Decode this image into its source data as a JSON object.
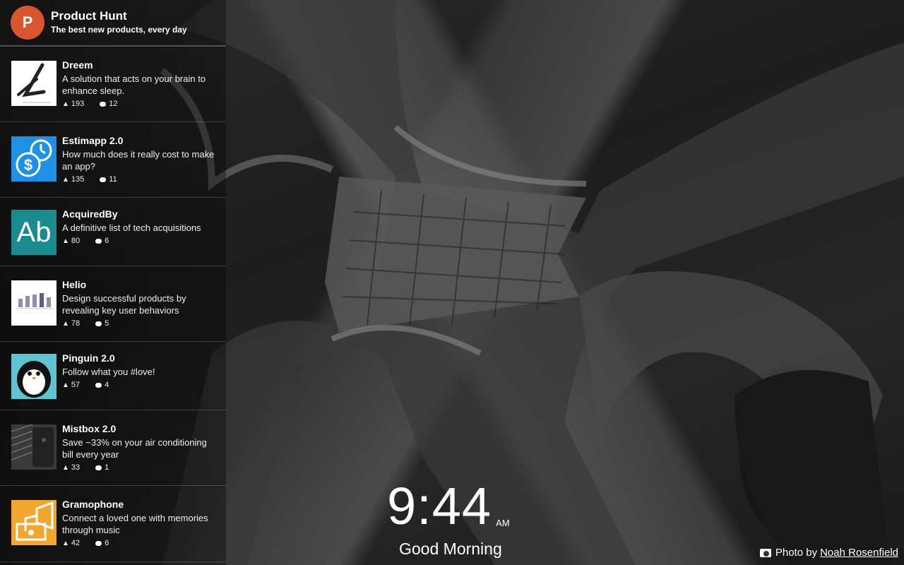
{
  "header": {
    "logo_letter": "P",
    "title": "Product Hunt",
    "subtitle": "The best new products, every day"
  },
  "posts": [
    {
      "name": "Dreem",
      "tagline": "A solution that acts on your brain to enhance sleep.",
      "votes": "193",
      "comments": "12"
    },
    {
      "name": "Estimapp 2.0",
      "tagline": "How much does it really cost to make an app?",
      "votes": "135",
      "comments": "11"
    },
    {
      "name": "AcquiredBy",
      "tagline": "A definitive list of tech acquisitions",
      "votes": "80",
      "comments": "6"
    },
    {
      "name": "Helio",
      "tagline": "Design successful products by revealing key user behaviors",
      "votes": "78",
      "comments": "5"
    },
    {
      "name": "Pinguin 2.0",
      "tagline": "Follow what you #love!",
      "votes": "57",
      "comments": "4"
    },
    {
      "name": "Mistbox 2.0",
      "tagline": "Save ~33% on your air conditioning bill every year",
      "votes": "33",
      "comments": "1"
    },
    {
      "name": "Gramophone",
      "tagline": "Connect a loved one with memories through music",
      "votes": "42",
      "comments": "6"
    }
  ],
  "thumbs": {
    "acquiredby_text": "Ab"
  },
  "clock": {
    "time": "9:44",
    "ampm": "AM"
  },
  "greeting": "Good Morning",
  "credit": {
    "prefix": "Photo by",
    "author": "Noah Rosenfield"
  },
  "colors": {
    "brand": "#da552f",
    "estimapp": "#1e90e6",
    "acquiredby": "#1b8a8f",
    "pinguin": "#5fc3d1",
    "gramophone": "#f2a62f"
  }
}
